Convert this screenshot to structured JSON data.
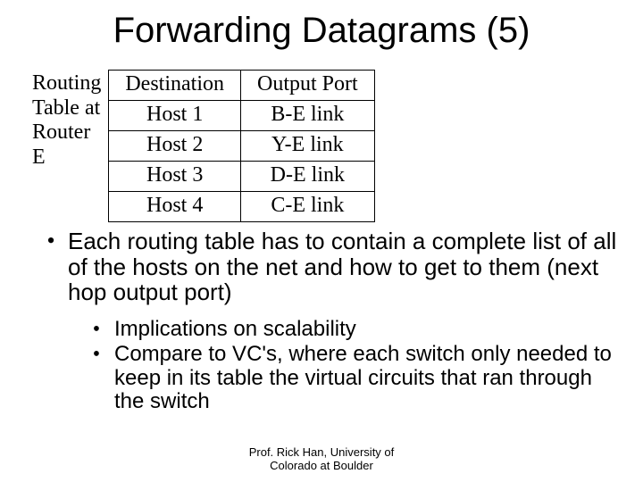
{
  "title": "Forwarding Datagrams (5)",
  "table": {
    "caption_l1": "Routing",
    "caption_l2": "Table at",
    "caption_l3": "Router",
    "caption_l4": "E",
    "headers": {
      "c0": "Destination",
      "c1": "Output Port"
    },
    "rows": [
      {
        "c0": "Host 1",
        "c1": "B-E link"
      },
      {
        "c0": "Host 2",
        "c1": "Y-E link"
      },
      {
        "c0": "Host 3",
        "c1": "D-E link"
      },
      {
        "c0": "Host 4",
        "c1": "C-E link"
      }
    ]
  },
  "bullets": {
    "main": "Each routing table has to contain a complete list of all of the hosts on the net and how to get to them (next hop output port)",
    "sub": [
      "Implications on scalability",
      "Compare to VC's, where each switch only needed to keep in its table the virtual circuits that ran through the switch"
    ]
  },
  "footer_l1": "Prof. Rick Han, University of",
  "footer_l2": "Colorado at Boulder",
  "glyphs": {
    "bullet": "•"
  }
}
